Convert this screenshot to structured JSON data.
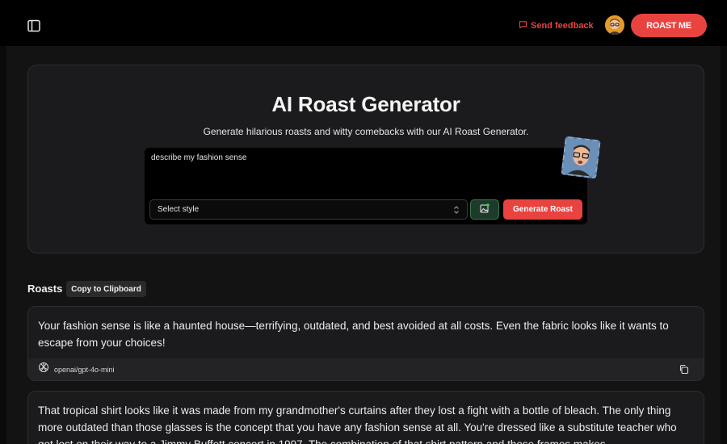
{
  "header": {
    "sidebar_toggle_icon": "sidebar-toggle-icon",
    "feedback_icon": "message-square-icon",
    "feedback_label": "Send feedback",
    "avatar_icon": "user-avatar",
    "roast_me_label": "ROAST ME",
    "accent_color": "#e9433f"
  },
  "hero": {
    "title": "AI Roast Generator",
    "subtitle": "Generate hilarious roasts and witty comebacks with our AI Roast Generator.",
    "prompt_value": "describe my fashion sense",
    "style_select": {
      "selected": "Select style",
      "chevron_icon": "chevrons-up-down-icon"
    },
    "image_button_icon": "image-plus-icon",
    "generate_label": "Generate Roast",
    "photo_icon": "uploaded-photo-thumbnail"
  },
  "roasts": {
    "label": "Roasts",
    "copy_clipboard_label": "Copy to Clipboard",
    "items": [
      {
        "text": "Your fashion sense is like a haunted house—terrifying, outdated, and best avoided at all costs. Even the fabric looks like it wants to escape from your choices!",
        "model": "openai/gpt-4o-mini",
        "model_icon": "openai-logo-icon",
        "copy_icon": "copy-icon"
      },
      {
        "text": "That tropical shirt looks like it was made from my grandmother's curtains after they lost a fight with a bottle of bleach. The only thing more outdated than those glasses is the concept that you have any fashion sense at all. You're dressed like a substitute teacher who got lost on their way to a Jimmy Buffett concert in 1997. The combination of that shirt pattern and those frames makes"
      }
    ]
  }
}
